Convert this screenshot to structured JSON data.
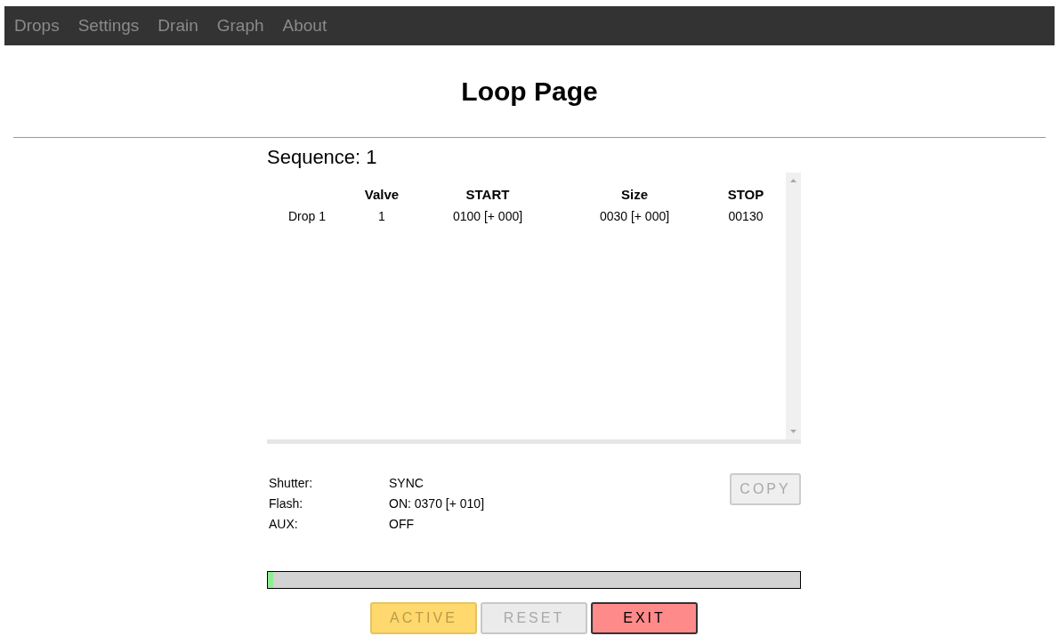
{
  "nav": {
    "items": [
      {
        "label": "Drops"
      },
      {
        "label": "Settings"
      },
      {
        "label": "Drain"
      },
      {
        "label": "Graph"
      },
      {
        "label": "About"
      }
    ]
  },
  "page_title": "Loop Page",
  "sequence_label": "Sequence: 1",
  "table": {
    "columns": [
      "",
      "Valve",
      "START",
      "Size",
      "STOP"
    ],
    "rows": [
      [
        "Drop 1",
        "1",
        "0100 [+ 000]",
        "0030 [+ 000]",
        "00130"
      ]
    ]
  },
  "outputs": [
    {
      "label": "Shutter:",
      "value": "SYNC"
    },
    {
      "label": "Flash:",
      "value": "ON: 0370 [+ 010]"
    },
    {
      "label": "AUX:",
      "value": "OFF"
    }
  ],
  "copy_button": {
    "label": "COPY",
    "disabled": true
  },
  "progress": {
    "level": 0.01
  },
  "buttons": [
    {
      "label": "ACTIVE",
      "kind": "active",
      "disabled": true
    },
    {
      "label": "RESET",
      "kind": "reset",
      "disabled": true
    },
    {
      "label": "EXIT",
      "kind": "exit",
      "disabled": false
    }
  ]
}
